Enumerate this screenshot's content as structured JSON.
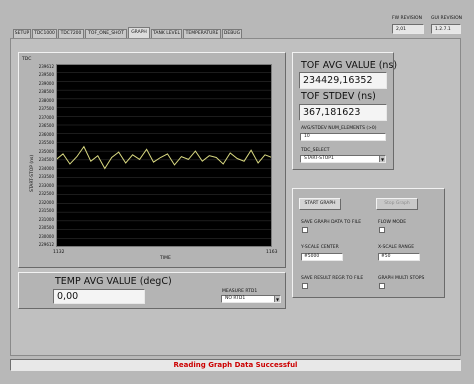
{
  "header": {
    "fw_revision_label": "FW REVISION",
    "fw_revision_value": "2,01",
    "gui_revision_label": "GUI REVISION",
    "gui_revision_value": "1.2.7.1"
  },
  "tabs": [
    {
      "label": "SETUP"
    },
    {
      "label": "TDC1000"
    },
    {
      "label": "TDC7200"
    },
    {
      "label": "TOF_ONE_SHOT"
    },
    {
      "label": "GRAPH"
    },
    {
      "label": "TANK LEVEL"
    },
    {
      "label": "TEMPERATURE"
    },
    {
      "label": "DEBUG"
    }
  ],
  "active_tab": "GRAPH",
  "graph": {
    "title": "TDC",
    "ylabel": "START-STOP (ns)",
    "xlabel": "TIME",
    "x_start": "1132",
    "x_end": "1163",
    "yticks": [
      "239612",
      "239500",
      "239000",
      "238500",
      "238000",
      "237500",
      "237000",
      "236500",
      "236000",
      "235500",
      "235000",
      "234500",
      "234000",
      "233500",
      "233000",
      "232500",
      "232000",
      "231500",
      "231000",
      "230500",
      "230000",
      "229612"
    ]
  },
  "chart_data": {
    "type": "line",
    "title": "TDC",
    "xlabel": "TIME",
    "ylabel": "START-STOP (ns)",
    "xlim": [
      1132,
      1163
    ],
    "ylim": [
      229612,
      239612
    ],
    "x": [
      1132,
      1133,
      1134,
      1135,
      1136,
      1137,
      1138,
      1139,
      1140,
      1141,
      1142,
      1143,
      1144,
      1145,
      1146,
      1147,
      1148,
      1149,
      1150,
      1151,
      1152,
      1153,
      1154,
      1155,
      1156,
      1157,
      1158,
      1159,
      1160,
      1161,
      1162,
      1163
    ],
    "series": [
      {
        "values": [
          234380,
          234700,
          234150,
          234550,
          235100,
          234300,
          234600,
          233900,
          234500,
          234800,
          234200,
          234650,
          234400,
          234950,
          234250,
          234500,
          234700,
          234100,
          234550,
          234400,
          234850,
          234300,
          234600,
          234500,
          234150,
          234750,
          234450,
          234300,
          234900,
          234200,
          234650,
          234500
        ]
      }
    ],
    "colors": {
      "line": "#d8d880",
      "background": "#000000",
      "grid": "#3a3a3a"
    }
  },
  "tof": {
    "avg_label": "TOF AVG VALUE (ns)",
    "avg_value": "234429,16352",
    "stdev_label": "TOF STDEV (ns)",
    "stdev_value": "367,181623",
    "avg_num_label": "AVG/STDEV NUM_ELEMENTS (>0)",
    "avg_num_value": "10",
    "tdc_select_label": "TDC_SELECT",
    "tdc_select_value": "START-STOP1"
  },
  "controls": {
    "start_graph": "START GRAPH",
    "stop_graph": "Stop Graph",
    "save_graph_label": "SAVE GRAPH DATA TO FILE",
    "flow_mode_label": "FLOW MODE",
    "yscale_label": "Y-SCALE CENTER",
    "yscale_value": "#5000",
    "xscale_label": "X-SCALE RANGE",
    "xscale_value": "#50",
    "save_result_label": "SAVE RESULT REGR TO FILE",
    "graph_multi_label": "GRAPH MULTI STOPS"
  },
  "temp": {
    "label": "TEMP AVG VALUE (degC)",
    "value": "0,00",
    "measure_label": "MEASURE RTD1",
    "measure_value": "NO RTD1"
  },
  "status": {
    "message": "Reading Graph Data Successful",
    "color": "#cc0000"
  }
}
